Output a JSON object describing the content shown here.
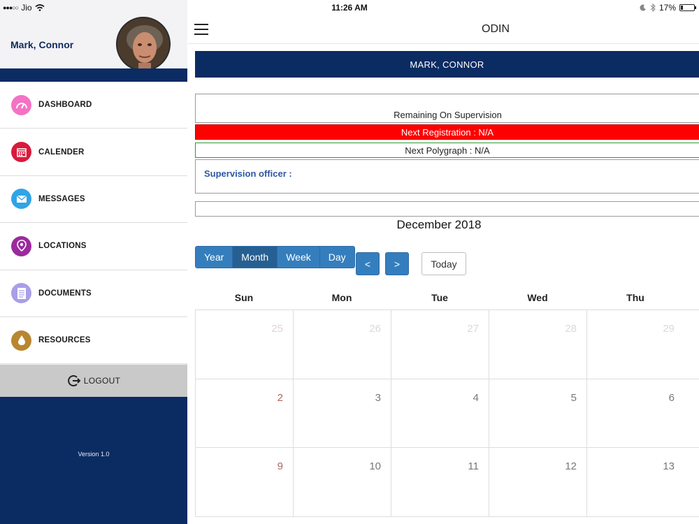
{
  "status_bar": {
    "carrier": "Jio",
    "time": "11:26 AM",
    "battery": "17%",
    "battery_level": 0.17
  },
  "sidebar": {
    "user_name": "Mark, Connor",
    "menu": [
      {
        "label": "DASHBOARD",
        "icon": "dashboard-gauge-icon",
        "color": "#f472c4"
      },
      {
        "label": "CALENDER",
        "icon": "calendar-icon",
        "color": "#d81b3c"
      },
      {
        "label": "MESSAGES",
        "icon": "envelope-icon",
        "color": "#2fa4e7"
      },
      {
        "label": "LOCATIONS",
        "icon": "map-pin-icon",
        "color": "#9b2a9e"
      },
      {
        "label": "DOCUMENTS",
        "icon": "document-icon",
        "color": "#a99ee8"
      },
      {
        "label": "RESOURCES",
        "icon": "drop-icon",
        "color": "#b8862f"
      }
    ],
    "logout_label": "LOGOUT",
    "version": "Version 1.0"
  },
  "header": {
    "title": "ODIN"
  },
  "profile": {
    "name_banner": "MARK, CONNOR",
    "remaining": "Remaining On Supervision",
    "next_registration": "Next Registration : N/A",
    "next_polygraph": "Next Polygraph : N/A",
    "supervision_officer": "Supervision officer :"
  },
  "calendar": {
    "title": "December 2018",
    "views": [
      "Year",
      "Month",
      "Week",
      "Day"
    ],
    "active_view": "Month",
    "prev_label": "<",
    "next_label": ">",
    "today_label": "Today",
    "day_names": [
      "Sun",
      "Mon",
      "Tue",
      "Wed",
      "Thu"
    ],
    "weeks": [
      [
        {
          "d": "25",
          "other": true
        },
        {
          "d": "26",
          "other": true
        },
        {
          "d": "27",
          "other": true
        },
        {
          "d": "28",
          "other": true
        },
        {
          "d": "29",
          "other": true
        }
      ],
      [
        {
          "d": "2"
        },
        {
          "d": "3"
        },
        {
          "d": "4"
        },
        {
          "d": "5"
        },
        {
          "d": "6"
        }
      ],
      [
        {
          "d": "9"
        },
        {
          "d": "10"
        },
        {
          "d": "11"
        },
        {
          "d": "12"
        },
        {
          "d": "13"
        }
      ]
    ]
  },
  "colors": {
    "navy": "#0b2b63",
    "registration_red": "#ff0000",
    "polygraph_green": "#2f9a2f",
    "button_blue": "#357ebd"
  }
}
